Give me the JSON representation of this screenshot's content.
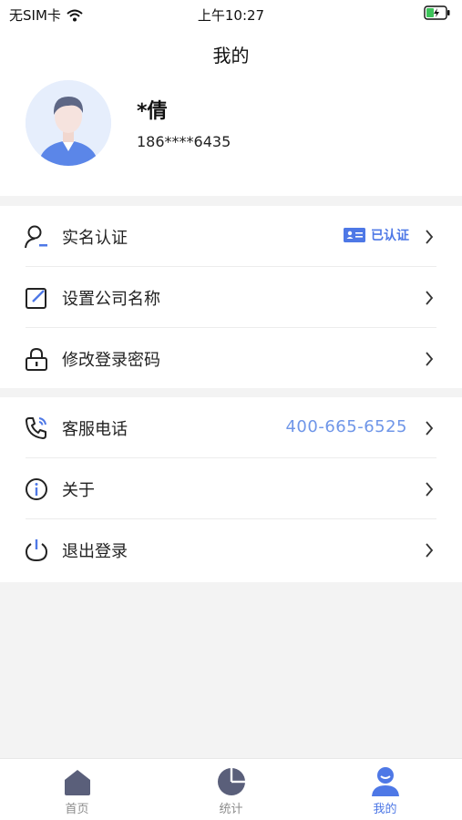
{
  "status_bar": {
    "carrier": "无SIM卡",
    "time": "上午10:27"
  },
  "header": {
    "title": "我的"
  },
  "profile": {
    "name": "*倩",
    "phone": "186****6435"
  },
  "menu_group_1": [
    {
      "label": "实名认证",
      "icon": "user-verify-icon",
      "badge": "已认证"
    },
    {
      "label": "设置公司名称",
      "icon": "edit-icon"
    },
    {
      "label": "修改登录密码",
      "icon": "lock-icon"
    }
  ],
  "menu_group_2": [
    {
      "label": "客服电话",
      "icon": "phone-icon",
      "value": "400-665-6525"
    },
    {
      "label": "关于",
      "icon": "info-icon"
    },
    {
      "label": "退出登录",
      "icon": "power-icon"
    }
  ],
  "tabbar": {
    "tabs": [
      {
        "label": "首页",
        "icon": "home-icon",
        "active": false
      },
      {
        "label": "统计",
        "icon": "pie-chart-icon",
        "active": false
      },
      {
        "label": "我的",
        "icon": "user-icon",
        "active": true
      }
    ]
  },
  "colors": {
    "accent": "#4e78e6",
    "accent_light": "#6f96e8",
    "tab_inactive_icon": "#5a5f7a",
    "background": "#f3f3f3"
  }
}
